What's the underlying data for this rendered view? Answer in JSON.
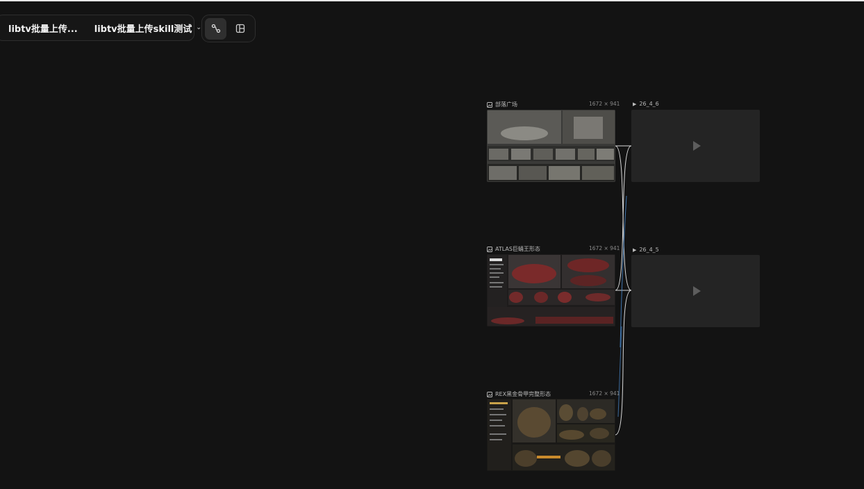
{
  "toolbar": {
    "breadcrumb_root": "libtv批量上传...",
    "breadcrumb_current": "libtv批量上传skill测试",
    "chevron": "⌄"
  },
  "canvas": {
    "image_nodes": [
      {
        "title": "部落广场",
        "size": "1672 × 941",
        "icon": "image-icon"
      },
      {
        "title": "ATLAS巨蛹王形态",
        "size": "1672 × 941",
        "icon": "image-icon"
      },
      {
        "title": "REX黑金骨甲完整形态",
        "size": "1672 × 941",
        "icon": "image-icon"
      }
    ],
    "video_nodes": [
      {
        "title": "26_4_6",
        "icon": "play-icon"
      },
      {
        "title": "26_4_5",
        "icon": "play-icon"
      }
    ]
  },
  "colors": {
    "background": "#131313",
    "wire": "#d9d9d9",
    "wire_accent": "#4b8fd6"
  }
}
